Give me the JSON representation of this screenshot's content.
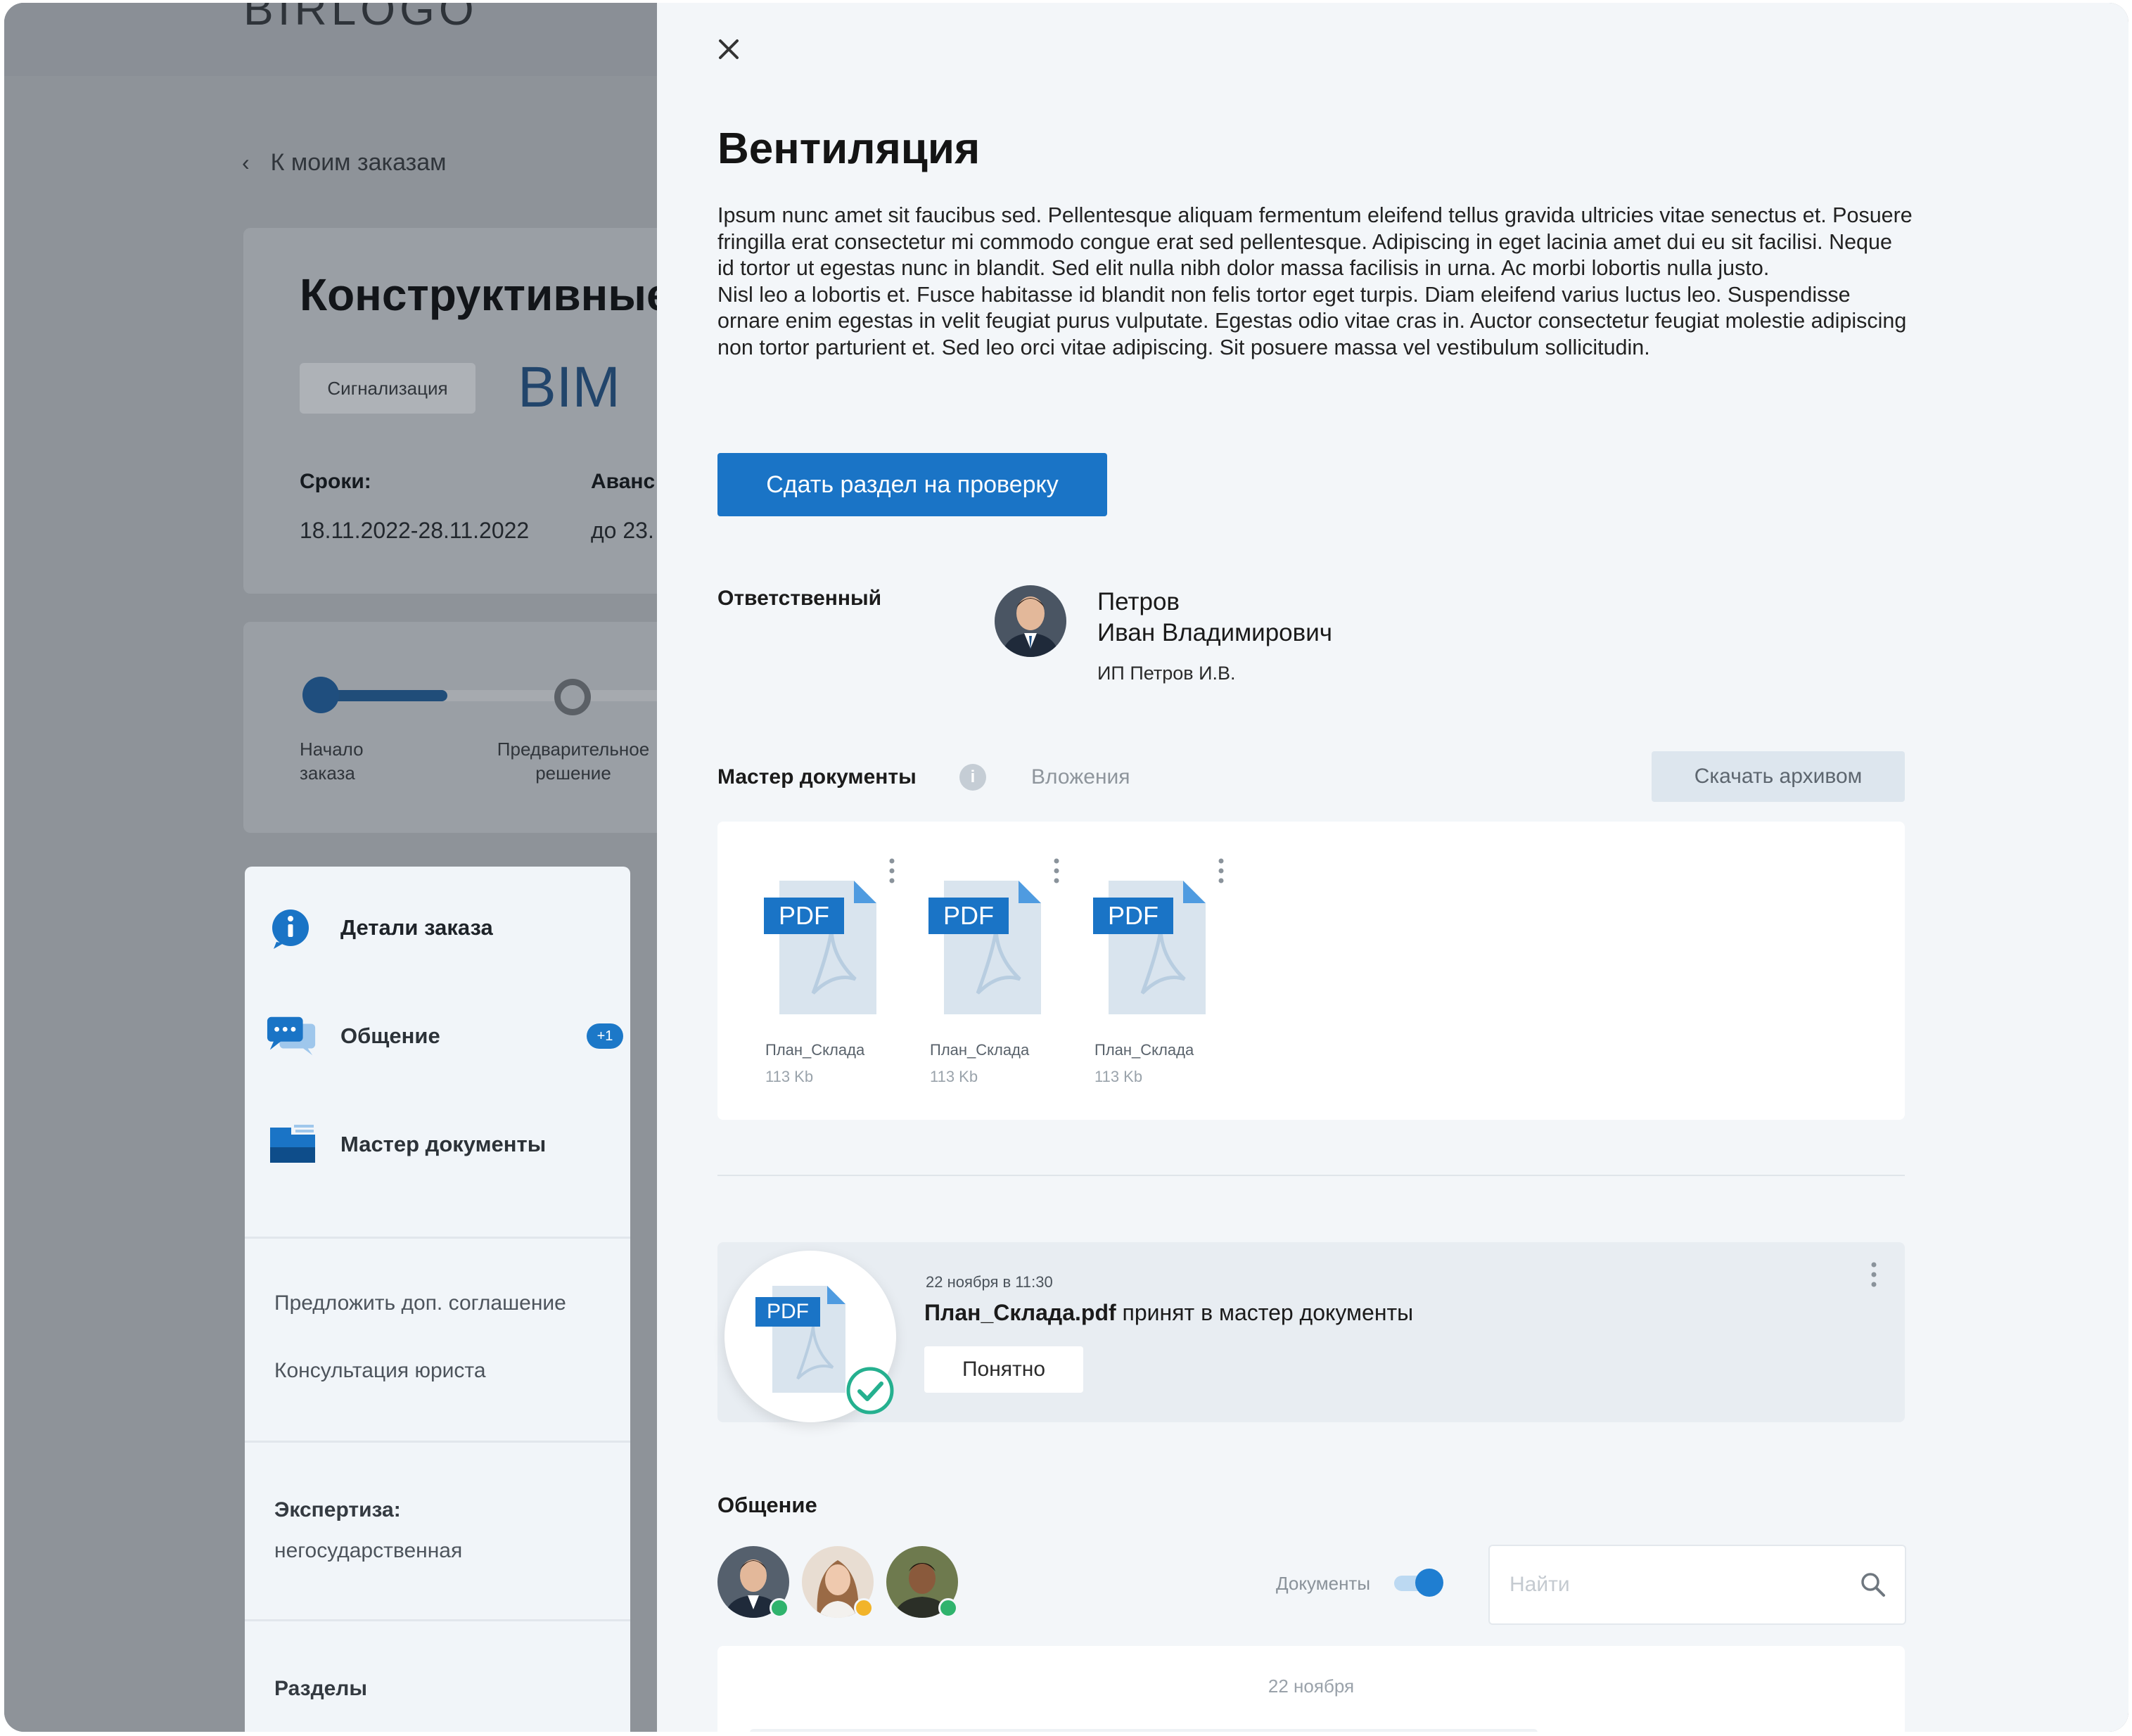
{
  "background": {
    "logo": "BIRLOGO",
    "back_link": "К моим заказам",
    "order_title": "Конструктивные",
    "tag": "Сигнализация",
    "bim_label": "BIM",
    "terms_label": "Сроки:",
    "terms_value": "18.11.2022-28.11.2022",
    "advance_label": "Аванс",
    "advance_value": "до 23.",
    "progress_steps": [
      {
        "line1": "Начало",
        "line2": "заказа"
      },
      {
        "line1": "Предварительное",
        "line2": "решение"
      }
    ],
    "sidebar": {
      "items": [
        {
          "label": "Детали заказа",
          "icon": "info-icon"
        },
        {
          "label": "Общение",
          "icon": "chat-icon",
          "badge": "+1"
        },
        {
          "label": "Мастер документы",
          "icon": "folder-icon"
        }
      ],
      "links": [
        "Предложить доп. соглашение",
        "Консультация юриста"
      ],
      "expertise_label": "Экспертиза:",
      "expertise_value": "негосударственная",
      "sections_label": "Разделы"
    }
  },
  "panel": {
    "title": "Вентиляция",
    "description": [
      "Ipsum nunc amet sit faucibus sed. Pellentesque aliquam fermentum eleifend tellus gravida ultricies vitae senectus et. Posuere fringilla erat consectetur mi commodo congue erat sed pellentesque. Adipiscing in eget lacinia amet dui eu sit facilisi. Neque id tortor ut egestas nunc in blandit. Sed elit nulla nibh dolor massa facilisis in urna. Ac morbi lobortis nulla justo.",
      "Nisl leo a lobortis et. Fusce habitasse id blandit non felis tortor eget turpis. Diam eleifend varius luctus leo. Suspendisse ornare enim egestas in velit feugiat purus vulputate. Egestas odio vitae cras in. Auctor consectetur feugiat molestie adipiscing non tortor parturient et. Sed leo orci vitae adipiscing. Sit posuere massa vel vestibulum sollicitudin."
    ],
    "submit_button": "Сдать раздел на проверку",
    "responsible": {
      "label": "Ответственный",
      "surname": "Петров",
      "name": "Иван Владимирович",
      "org": "ИП Петров И.В."
    },
    "docs_tabs": {
      "active": "Мастер документы",
      "inactive": "Вложения",
      "download_button": "Скачать архивом"
    },
    "files": [
      {
        "badge": "PDF",
        "name": "План_Склада",
        "size": "113 Kb"
      },
      {
        "badge": "PDF",
        "name": "План_Склада",
        "size": "113 Kb"
      },
      {
        "badge": "PDF",
        "name": "План_Склада",
        "size": "113 Kb"
      }
    ],
    "notification": {
      "badge": "PDF",
      "date": "22 ноября в 11:30",
      "file": "План_Склада.pdf",
      "message": " принят в мастер документы",
      "button": "Понятно"
    },
    "chat": {
      "title": "Общение",
      "docs_toggle_label": "Документы",
      "docs_toggle_on": true,
      "search_placeholder": "Найти",
      "feed_date": "22 ноября",
      "participants": [
        {
          "status_color": "#2fb36d"
        },
        {
          "status_color": "#f2b42a"
        },
        {
          "status_color": "#2fb36d"
        }
      ]
    },
    "accent_color": "#1a74c6"
  }
}
